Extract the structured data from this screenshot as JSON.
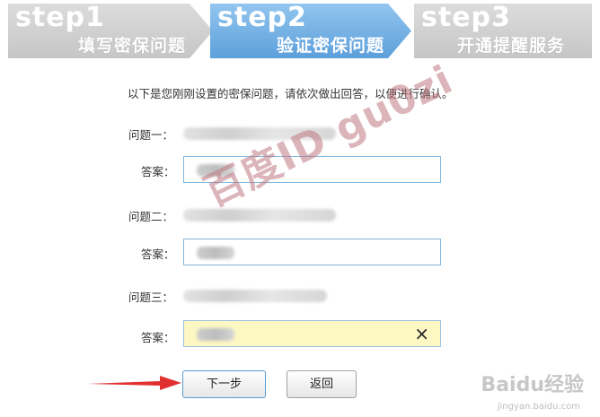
{
  "steps": [
    {
      "num": "step1",
      "label": "填写密保问题"
    },
    {
      "num": "step2",
      "label": "验证密保问题"
    },
    {
      "num": "step3",
      "label": "开通提醒服务"
    }
  ],
  "instruction": "以下是您刚刚设置的密保问题，请依次做出回答，以便进行确认。",
  "questions": [
    {
      "label": "问题一：",
      "answer_label": "答案："
    },
    {
      "label": "问题二：",
      "answer_label": "答案："
    },
    {
      "label": "问题三：",
      "answer_label": "答案："
    }
  ],
  "clear_icon": "×",
  "buttons": {
    "next": "下一步",
    "back": "返回"
  },
  "watermark": "百度ID gu0zi",
  "branding": {
    "logo": "Baidu经验",
    "url": "jingyan.baidu.com"
  },
  "colors": {
    "step_active": "#5d9fdb",
    "step_inactive": "#c6c6c6",
    "input_focus_bg": "#fdf7c4",
    "arrow": "#e03030"
  }
}
